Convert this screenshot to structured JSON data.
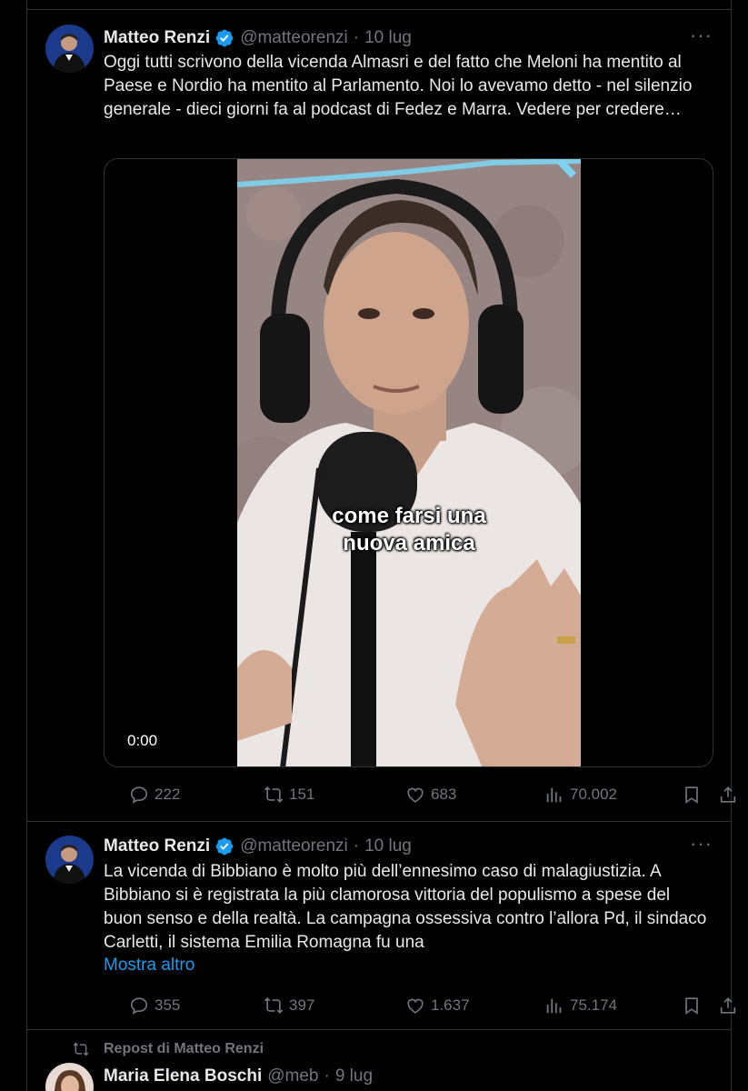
{
  "tweets": [
    {
      "name": "Matteo Renzi",
      "handle": "@matteorenzi",
      "time": "10 lug",
      "text": "Oggi tutti scrivono della vicenda Almasri e del fatto che Meloni ha mentito al Paese e Nordio ha mentito al Parlamento. Noi lo avevamo detto - nel silenzio generale - dieci giorni fa al podcast di Fedez e Marra. Vedere per credere…",
      "video": {
        "caption_line1": "come farsi una",
        "caption_line2": "nuova amica",
        "timestamp": "0:00"
      },
      "stats": {
        "replies": "222",
        "reposts": "151",
        "likes": "683",
        "views": "70.002"
      }
    },
    {
      "name": "Matteo Renzi",
      "handle": "@matteorenzi",
      "time": "10 lug",
      "text": "La vicenda di Bibbiano è molto più dell’ennesimo caso di malagiustizia. A Bibbiano si è registrata la più clamorosa vittoria del populismo a spese del buon senso e della realtà. La campagna ossessiva contro l’allora Pd, il sindaco Carletti, il sistema Emilia Romagna fu una",
      "show_more": "Mostra altro",
      "stats": {
        "replies": "355",
        "reposts": "397",
        "likes": "1.637",
        "views": "75.174"
      }
    },
    {
      "repost_label": "Repost di Matteo Renzi",
      "name": "Maria Elena Boschi",
      "handle": "@meb",
      "time": "9 lug"
    }
  ],
  "ui": {
    "separator": "·",
    "more_menu": "···"
  },
  "colors": {
    "background": "#000000",
    "text": "#e7e9ea",
    "secondary": "#71767b",
    "link": "#1d9bf0",
    "verified": "#1d9bf0",
    "border": "#2f3336"
  },
  "icons": [
    "verified-badge-icon",
    "more-icon",
    "reply-icon",
    "repost-icon",
    "like-icon",
    "views-icon",
    "bookmark-icon",
    "share-icon"
  ]
}
